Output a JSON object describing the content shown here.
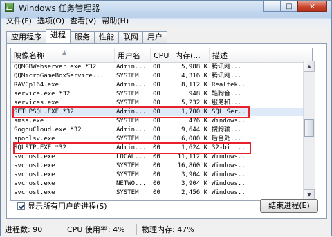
{
  "window": {
    "title": "Windows 任务管理器",
    "minimize": "─",
    "maximize": "□",
    "close": "✕"
  },
  "menu": [
    "文件(F)",
    "选项(O)",
    "查看(V)",
    "帮助(H)"
  ],
  "tabs": [
    {
      "label": "应用程序",
      "active": false
    },
    {
      "label": "进程",
      "active": true
    },
    {
      "label": "服务",
      "active": false
    },
    {
      "label": "性能",
      "active": false
    },
    {
      "label": "联网",
      "active": false
    },
    {
      "label": "用户",
      "active": false
    }
  ],
  "columns": {
    "name": "映像名称",
    "user": "用户名",
    "cpu": "CPU",
    "mem": "内存(...",
    "desc": "描述"
  },
  "sort_indicator": "▲",
  "rows": [
    {
      "name": "QQMGBWebserver.exe *32",
      "user": "Admin...",
      "cpu": "00",
      "mem": "5,988 K",
      "desc": "腾讯网..."
    },
    {
      "name": "QQMicroGameBoxService...",
      "user": "SYSTEM",
      "cpu": "00",
      "mem": "4,316 K",
      "desc": "腾讯网..."
    },
    {
      "name": "RAVCp164.exe",
      "user": "Admin...",
      "cpu": "00",
      "mem": "8,112 K",
      "desc": "Realtek..."
    },
    {
      "name": "service.exe *32",
      "user": "SYSTEM",
      "cpu": "00",
      "mem": "948 K",
      "desc": "酷狗音..."
    },
    {
      "name": "services.exe",
      "user": "SYSTEM",
      "cpu": "00",
      "mem": "5,232 K",
      "desc": "服务和..."
    },
    {
      "name": "SETUPSQL.EXE *32",
      "user": "Admin...",
      "cpu": "00",
      "mem": "1,700 K",
      "desc": "SQL Ser..."
    },
    {
      "name": "smss.exe",
      "user": "SYSTEM",
      "cpu": "00",
      "mem": "476 K",
      "desc": "Windows..."
    },
    {
      "name": "SogouCloud.exe *32",
      "user": "Admin...",
      "cpu": "00",
      "mem": "9,644 K",
      "desc": "搜狗输..."
    },
    {
      "name": "spoolsv.exe",
      "user": "SYSTEM",
      "cpu": "00",
      "mem": "6,000 K",
      "desc": "后台处..."
    },
    {
      "name": "SQLSTP.EXE *32",
      "user": "Admin...",
      "cpu": "00",
      "mem": "1,624 K",
      "desc": "32-bit ..."
    },
    {
      "name": "svchost.exe",
      "user": "LOCAL...",
      "cpu": "00",
      "mem": "11,112 K",
      "desc": "Windows..."
    },
    {
      "name": "svchost.exe",
      "user": "SYSTEM",
      "cpu": "00",
      "mem": "16,860 K",
      "desc": "Windows..."
    },
    {
      "name": "svchost.exe",
      "user": "SYSTEM",
      "cpu": "00",
      "mem": "3,904 K",
      "desc": "Windows..."
    },
    {
      "name": "svchost.exe",
      "user": "NETWO...",
      "cpu": "00",
      "mem": "3,904 K",
      "desc": "Windows..."
    },
    {
      "name": "svchost.exe",
      "user": "SYSTEM",
      "cpu": "00",
      "mem": "2,456 K",
      "desc": "Windows..."
    }
  ],
  "show_all_processes": {
    "label": "显示所有用户的进程(S)",
    "checked": true
  },
  "end_process_button": "结束进程(E)",
  "status": {
    "processes": "进程数: 90",
    "cpu": "CPU 使用率: 4%",
    "memory": "物理内存: 47%"
  },
  "colors": {
    "highlight_box": "#e8202a",
    "selected_row": "#dfeaf8"
  }
}
